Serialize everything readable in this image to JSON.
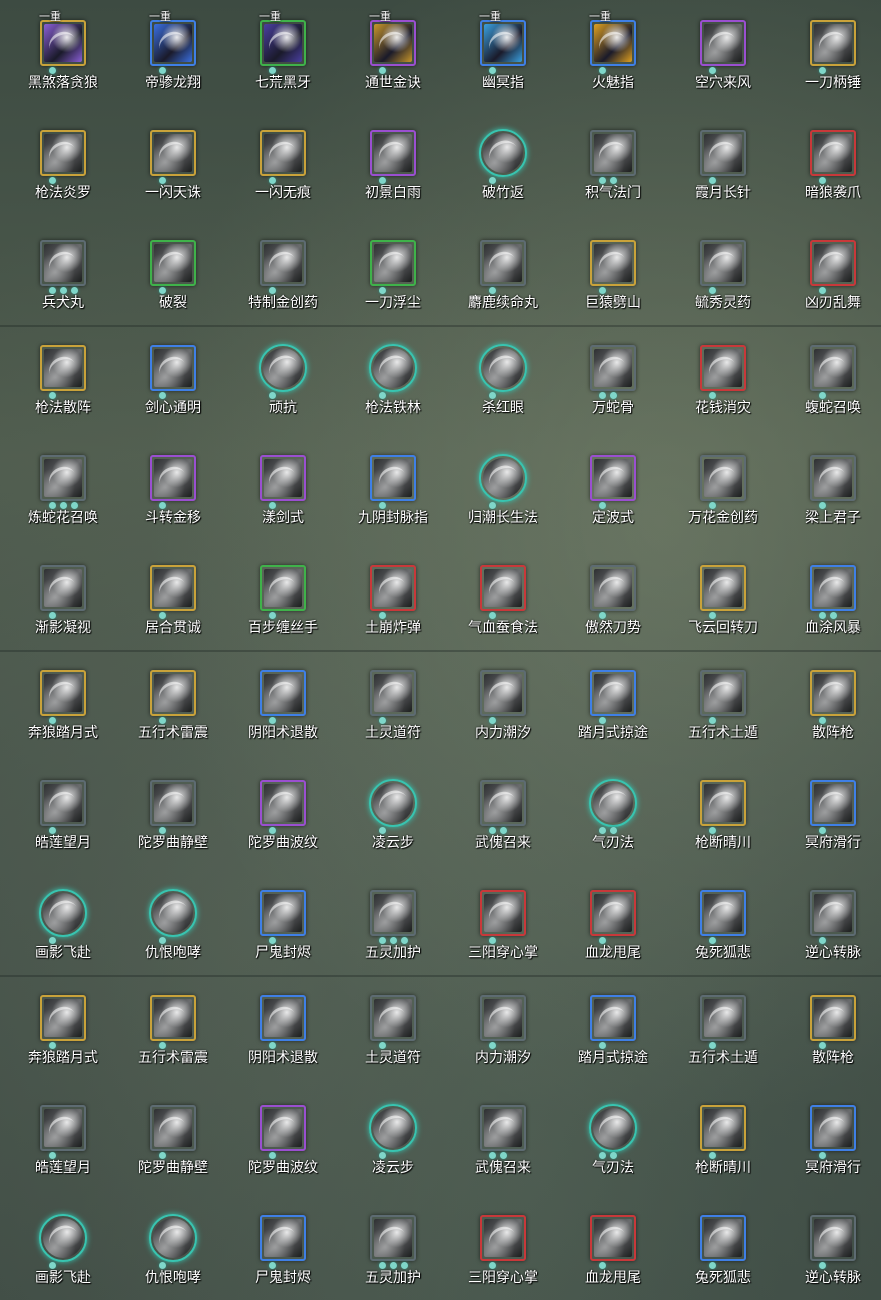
{
  "grid": {
    "rows": [
      [
        {
          "name": "黑煞落贪狼",
          "tier": "gold",
          "level": "一重",
          "dots": 1,
          "icon": "wolf-slash-skill-icon",
          "tint": "#8a5fd6"
        },
        {
          "name": "帝骖龙翔",
          "tier": "blue",
          "level": "一重",
          "dots": 1,
          "icon": "dragon-sweep-skill-icon",
          "tint": "#3a6fe0"
        },
        {
          "name": "七荒黑牙",
          "tier": "green",
          "level": "一重",
          "dots": 1,
          "icon": "dark-fang-skill-icon",
          "tint": "#4a3fa0"
        },
        {
          "name": "通世金诀",
          "tier": "purple",
          "level": "一重",
          "dots": 1,
          "icon": "gold-art-skill-icon",
          "tint": "#c8962a"
        },
        {
          "name": "幽冥指",
          "tier": "blue",
          "level": "一重",
          "dots": 1,
          "icon": "nether-finger-skill-icon",
          "tint": "#3aa0e0"
        },
        {
          "name": "火魅指",
          "tier": "blue",
          "level": "一重",
          "dots": 1,
          "icon": "fire-finger-skill-icon",
          "tint": "#e0a020"
        },
        {
          "name": "空穴来风",
          "tier": "purple",
          "level": "",
          "dots": 1,
          "icon": "wind-vortex-skill-icon",
          "tint": ""
        },
        {
          "name": "一刀柄锤",
          "tier": "gold",
          "level": "",
          "dots": 1,
          "icon": "hilt-strike-skill-icon",
          "tint": ""
        }
      ],
      [
        {
          "name": "枪法炎罗",
          "tier": "gold",
          "level": "",
          "dots": 1,
          "icon": "spear-flame-skill-icon",
          "tint": ""
        },
        {
          "name": "一闪天诛",
          "tier": "gold",
          "level": "",
          "dots": 1,
          "icon": "flash-strike-skill-icon",
          "tint": ""
        },
        {
          "name": "一闪无痕",
          "tier": "gold",
          "level": "",
          "dots": 1,
          "icon": "traceless-flash-skill-icon",
          "tint": ""
        },
        {
          "name": "初景白雨",
          "tier": "purple",
          "level": "",
          "dots": 1,
          "icon": "white-rain-skill-icon",
          "tint": ""
        },
        {
          "name": "破竹返",
          "tier": "teal-round",
          "level": "",
          "dots": 1,
          "icon": "bamboo-break-skill-icon",
          "tint": ""
        },
        {
          "name": "积气法门",
          "tier": "grey",
          "level": "",
          "dots": 2,
          "icon": "qi-gather-skill-icon",
          "tint": ""
        },
        {
          "name": "霞月长针",
          "tier": "grey",
          "level": "",
          "dots": 1,
          "icon": "long-needle-skill-icon",
          "tint": ""
        },
        {
          "name": "暗狼袭爪",
          "tier": "red",
          "level": "",
          "dots": 1,
          "icon": "wolf-claw-skill-icon",
          "tint": ""
        }
      ],
      [
        {
          "name": "兵犬丸",
          "tier": "grey",
          "level": "",
          "dots": 3,
          "icon": "hound-pill-skill-icon",
          "tint": ""
        },
        {
          "name": "破裂",
          "tier": "green",
          "level": "",
          "dots": 1,
          "icon": "rupture-skill-icon",
          "tint": ""
        },
        {
          "name": "特制金创药",
          "tier": "grey",
          "level": "",
          "dots": 1,
          "icon": "salve-skill-icon",
          "tint": ""
        },
        {
          "name": "一刀浮尘",
          "tier": "green",
          "level": "",
          "dots": 1,
          "icon": "dust-slash-skill-icon",
          "tint": ""
        },
        {
          "name": "麝鹿续命丸",
          "tier": "grey",
          "level": "",
          "dots": 1,
          "icon": "deer-pill-skill-icon",
          "tint": ""
        },
        {
          "name": "巨猿劈山",
          "tier": "gold",
          "level": "",
          "dots": 1,
          "icon": "ape-smash-skill-icon",
          "tint": ""
        },
        {
          "name": "毓秀灵药",
          "tier": "grey",
          "level": "",
          "dots": 1,
          "icon": "spirit-gourd-skill-icon",
          "tint": ""
        },
        {
          "name": "凶刃乱舞",
          "tier": "red",
          "level": "",
          "dots": 1,
          "icon": "blade-dance-skill-icon",
          "tint": ""
        }
      ],
      [
        {
          "name": "枪法散阵",
          "tier": "gold",
          "level": "",
          "dots": 1,
          "icon": "spear-scatter-skill-icon",
          "tint": ""
        },
        {
          "name": "剑心通明",
          "tier": "blue",
          "level": "",
          "dots": 1,
          "icon": "sword-heart-skill-icon",
          "tint": ""
        },
        {
          "name": "顽抗",
          "tier": "teal-round",
          "level": "",
          "dots": 1,
          "icon": "resist-skill-icon",
          "tint": ""
        },
        {
          "name": "枪法铁林",
          "tier": "teal-round",
          "level": "",
          "dots": 1,
          "icon": "iron-forest-skill-icon",
          "tint": ""
        },
        {
          "name": "杀红眼",
          "tier": "teal-round",
          "level": "",
          "dots": 1,
          "icon": "red-eye-skill-icon",
          "tint": ""
        },
        {
          "name": "万蛇骨",
          "tier": "grey",
          "level": "",
          "dots": 2,
          "icon": "snake-bone-skill-icon",
          "tint": ""
        },
        {
          "name": "花钱消灾",
          "tier": "red",
          "level": "",
          "dots": 1,
          "icon": "coin-pouch-skill-icon",
          "tint": ""
        },
        {
          "name": "蝮蛇召唤",
          "tier": "grey",
          "level": "",
          "dots": 1,
          "icon": "viper-summon-skill-icon",
          "tint": ""
        }
      ],
      [
        {
          "name": "炼蛇花召唤",
          "tier": "grey",
          "level": "",
          "dots": 3,
          "icon": "snake-flower-skill-icon",
          "tint": ""
        },
        {
          "name": "斗转金移",
          "tier": "purple",
          "level": "",
          "dots": 1,
          "icon": "gold-shift-skill-icon",
          "tint": ""
        },
        {
          "name": "漾剑式",
          "tier": "purple",
          "level": "",
          "dots": 1,
          "icon": "ripple-sword-skill-icon",
          "tint": ""
        },
        {
          "name": "九阴封脉指",
          "tier": "blue",
          "level": "",
          "dots": 1,
          "icon": "seal-finger-skill-icon",
          "tint": ""
        },
        {
          "name": "归潮长生法",
          "tier": "teal-round",
          "level": "",
          "dots": 1,
          "icon": "tide-longevity-skill-icon",
          "tint": ""
        },
        {
          "name": "定波式",
          "tier": "purple",
          "level": "",
          "dots": 1,
          "icon": "calm-wave-skill-icon",
          "tint": ""
        },
        {
          "name": "万花金创药",
          "tier": "grey",
          "level": "",
          "dots": 1,
          "icon": "flower-salve-skill-icon",
          "tint": ""
        },
        {
          "name": "梁上君子",
          "tier": "grey",
          "level": "",
          "dots": 1,
          "icon": "thief-skill-icon",
          "tint": ""
        }
      ],
      [
        {
          "name": "渐影凝视",
          "tier": "grey",
          "level": "",
          "dots": 1,
          "icon": "shadow-gaze-skill-icon",
          "tint": ""
        },
        {
          "name": "居合贯诚",
          "tier": "gold",
          "level": "",
          "dots": 1,
          "icon": "iai-pierce-skill-icon",
          "tint": ""
        },
        {
          "name": "百步缠丝手",
          "tier": "green",
          "level": "",
          "dots": 1,
          "icon": "silk-hand-skill-icon",
          "tint": ""
        },
        {
          "name": "土崩炸弹",
          "tier": "red",
          "level": "",
          "dots": 1,
          "icon": "earth-bomb-skill-icon",
          "tint": ""
        },
        {
          "name": "气血蚕食法",
          "tier": "red",
          "level": "",
          "dots": 1,
          "icon": "blood-drain-skill-icon",
          "tint": ""
        },
        {
          "name": "傲然刀势",
          "tier": "grey",
          "level": "",
          "dots": 1,
          "icon": "proud-blade-skill-icon",
          "tint": ""
        },
        {
          "name": "飞云回转刀",
          "tier": "gold",
          "level": "",
          "dots": 1,
          "icon": "cloud-spin-skill-icon",
          "tint": ""
        },
        {
          "name": "血涂风暴",
          "tier": "blue",
          "level": "",
          "dots": 2,
          "icon": "blood-storm-skill-icon",
          "tint": ""
        }
      ],
      [
        {
          "name": "奔狼踏月式",
          "tier": "gold",
          "level": "",
          "dots": 1,
          "icon": "wolf-moon-skill-icon",
          "tint": ""
        },
        {
          "name": "五行术雷震",
          "tier": "gold",
          "level": "",
          "dots": 1,
          "icon": "thunder-art-skill-icon",
          "tint": ""
        },
        {
          "name": "阴阳术退散",
          "tier": "blue",
          "level": "",
          "dots": 1,
          "icon": "yinyang-dispel-skill-icon",
          "tint": ""
        },
        {
          "name": "土灵道符",
          "tier": "grey",
          "level": "",
          "dots": 1,
          "icon": "earth-talisman-skill-icon",
          "tint": ""
        },
        {
          "name": "内力潮汐",
          "tier": "grey",
          "level": "",
          "dots": 1,
          "icon": "inner-tide-skill-icon",
          "tint": ""
        },
        {
          "name": "踏月式掠途",
          "tier": "blue",
          "level": "",
          "dots": 1,
          "icon": "moon-dash-skill-icon",
          "tint": ""
        },
        {
          "name": "五行术土遁",
          "tier": "grey",
          "level": "",
          "dots": 1,
          "icon": "earth-escape-skill-icon",
          "tint": ""
        },
        {
          "name": "散阵枪",
          "tier": "gold",
          "level": "",
          "dots": 1,
          "icon": "scatter-spear-skill-icon",
          "tint": ""
        }
      ],
      [
        {
          "name": "皓莲望月",
          "tier": "grey",
          "level": "",
          "dots": 1,
          "icon": "lotus-moon-skill-icon",
          "tint": ""
        },
        {
          "name": "陀罗曲静壁",
          "tier": "grey",
          "level": "",
          "dots": 1,
          "icon": "still-wall-skill-icon",
          "tint": ""
        },
        {
          "name": "陀罗曲波纹",
          "tier": "purple",
          "level": "",
          "dots": 1,
          "icon": "ripple-song-skill-icon",
          "tint": ""
        },
        {
          "name": "凌云步",
          "tier": "teal-round",
          "level": "",
          "dots": 1,
          "icon": "cloud-step-skill-icon",
          "tint": ""
        },
        {
          "name": "武傀召来",
          "tier": "grey",
          "level": "",
          "dots": 2,
          "icon": "puppet-summon-skill-icon",
          "tint": ""
        },
        {
          "name": "气刃法",
          "tier": "teal-round",
          "level": "",
          "dots": 2,
          "icon": "qi-blade-skill-icon",
          "tint": ""
        },
        {
          "name": "枪断晴川",
          "tier": "gold",
          "level": "",
          "dots": 1,
          "icon": "spear-river-skill-icon",
          "tint": ""
        },
        {
          "name": "冥府滑行",
          "tier": "blue",
          "level": "",
          "dots": 1,
          "icon": "underworld-glide-skill-icon",
          "tint": ""
        }
      ],
      [
        {
          "name": "画影飞赴",
          "tier": "teal-round",
          "level": "",
          "dots": 1,
          "icon": "shadow-flight-skill-icon",
          "tint": ""
        },
        {
          "name": "仇恨咆哮",
          "tier": "teal-round",
          "level": "",
          "dots": 1,
          "icon": "hate-roar-skill-icon",
          "tint": ""
        },
        {
          "name": "尸鬼封烬",
          "tier": "blue",
          "level": "",
          "dots": 1,
          "icon": "ghoul-seal-skill-icon",
          "tint": ""
        },
        {
          "name": "五灵加护",
          "tier": "grey",
          "level": "",
          "dots": 3,
          "icon": "five-spirits-skill-icon",
          "tint": ""
        },
        {
          "name": "三阳穿心掌",
          "tier": "red",
          "level": "",
          "dots": 1,
          "icon": "heart-palm-skill-icon",
          "tint": ""
        },
        {
          "name": "血龙甩尾",
          "tier": "red",
          "level": "",
          "dots": 1,
          "icon": "blood-dragon-skill-icon",
          "tint": ""
        },
        {
          "name": "兔死狐悲",
          "tier": "blue",
          "level": "",
          "dots": 1,
          "icon": "fox-grief-skill-icon",
          "tint": ""
        },
        {
          "name": "逆心转脉",
          "tier": "grey",
          "level": "",
          "dots": 1,
          "icon": "reverse-pulse-skill-icon",
          "tint": ""
        }
      ],
      [
        {
          "name": "奔狼踏月式",
          "tier": "gold",
          "level": "",
          "dots": 1,
          "icon": "wolf-moon-skill-icon",
          "tint": ""
        },
        {
          "name": "五行术雷震",
          "tier": "gold",
          "level": "",
          "dots": 1,
          "icon": "thunder-art-skill-icon",
          "tint": ""
        },
        {
          "name": "阴阳术退散",
          "tier": "blue",
          "level": "",
          "dots": 1,
          "icon": "yinyang-dispel-skill-icon",
          "tint": ""
        },
        {
          "name": "土灵道符",
          "tier": "grey",
          "level": "",
          "dots": 1,
          "icon": "earth-talisman-skill-icon",
          "tint": ""
        },
        {
          "name": "内力潮汐",
          "tier": "grey",
          "level": "",
          "dots": 1,
          "icon": "inner-tide-skill-icon",
          "tint": ""
        },
        {
          "name": "踏月式掠途",
          "tier": "blue",
          "level": "",
          "dots": 1,
          "icon": "moon-dash-skill-icon",
          "tint": ""
        },
        {
          "name": "五行术土遁",
          "tier": "grey",
          "level": "",
          "dots": 1,
          "icon": "earth-escape-skill-icon",
          "tint": ""
        },
        {
          "name": "散阵枪",
          "tier": "gold",
          "level": "",
          "dots": 1,
          "icon": "scatter-spear-skill-icon",
          "tint": ""
        }
      ],
      [
        {
          "name": "皓莲望月",
          "tier": "grey",
          "level": "",
          "dots": 1,
          "icon": "lotus-moon-skill-icon",
          "tint": ""
        },
        {
          "name": "陀罗曲静壁",
          "tier": "grey",
          "level": "",
          "dots": 1,
          "icon": "still-wall-skill-icon",
          "tint": ""
        },
        {
          "name": "陀罗曲波纹",
          "tier": "purple",
          "level": "",
          "dots": 1,
          "icon": "ripple-song-skill-icon",
          "tint": ""
        },
        {
          "name": "凌云步",
          "tier": "teal-round",
          "level": "",
          "dots": 1,
          "icon": "cloud-step-skill-icon",
          "tint": ""
        },
        {
          "name": "武傀召来",
          "tier": "grey",
          "level": "",
          "dots": 2,
          "icon": "puppet-summon-skill-icon",
          "tint": ""
        },
        {
          "name": "气刃法",
          "tier": "teal-round",
          "level": "",
          "dots": 2,
          "icon": "qi-blade-skill-icon",
          "tint": ""
        },
        {
          "name": "枪断晴川",
          "tier": "gold",
          "level": "",
          "dots": 1,
          "icon": "spear-river-skill-icon",
          "tint": ""
        },
        {
          "name": "冥府滑行",
          "tier": "blue",
          "level": "",
          "dots": 1,
          "icon": "underworld-glide-skill-icon",
          "tint": ""
        }
      ],
      [
        {
          "name": "画影飞赴",
          "tier": "teal-round",
          "level": "",
          "dots": 1,
          "icon": "shadow-flight-skill-icon",
          "tint": ""
        },
        {
          "name": "仇恨咆哮",
          "tier": "teal-round",
          "level": "",
          "dots": 1,
          "icon": "hate-roar-skill-icon",
          "tint": ""
        },
        {
          "name": "尸鬼封烬",
          "tier": "blue",
          "level": "",
          "dots": 1,
          "icon": "ghoul-seal-skill-icon",
          "tint": ""
        },
        {
          "name": "五灵加护",
          "tier": "grey",
          "level": "",
          "dots": 3,
          "icon": "five-spirits-skill-icon",
          "tint": ""
        },
        {
          "name": "三阳穿心掌",
          "tier": "red",
          "level": "",
          "dots": 1,
          "icon": "heart-palm-skill-icon",
          "tint": ""
        },
        {
          "name": "血龙甩尾",
          "tier": "red",
          "level": "",
          "dots": 1,
          "icon": "blood-dragon-skill-icon",
          "tint": ""
        },
        {
          "name": "兔死狐悲",
          "tier": "blue",
          "level": "",
          "dots": 1,
          "icon": "fox-grief-skill-icon",
          "tint": ""
        },
        {
          "name": "逆心转脉",
          "tier": "grey",
          "level": "",
          "dots": 1,
          "icon": "reverse-pulse-skill-icon",
          "tint": ""
        }
      ]
    ]
  },
  "colors": {
    "gold": "#c9a23a",
    "blue": "#3f7fe6",
    "green": "#3fb24a",
    "purple": "#9a4fd0",
    "red": "#c8383a",
    "grey": "#5d6b72",
    "teal-round": "#38c4b0",
    "dot": "#7fd6c9"
  }
}
